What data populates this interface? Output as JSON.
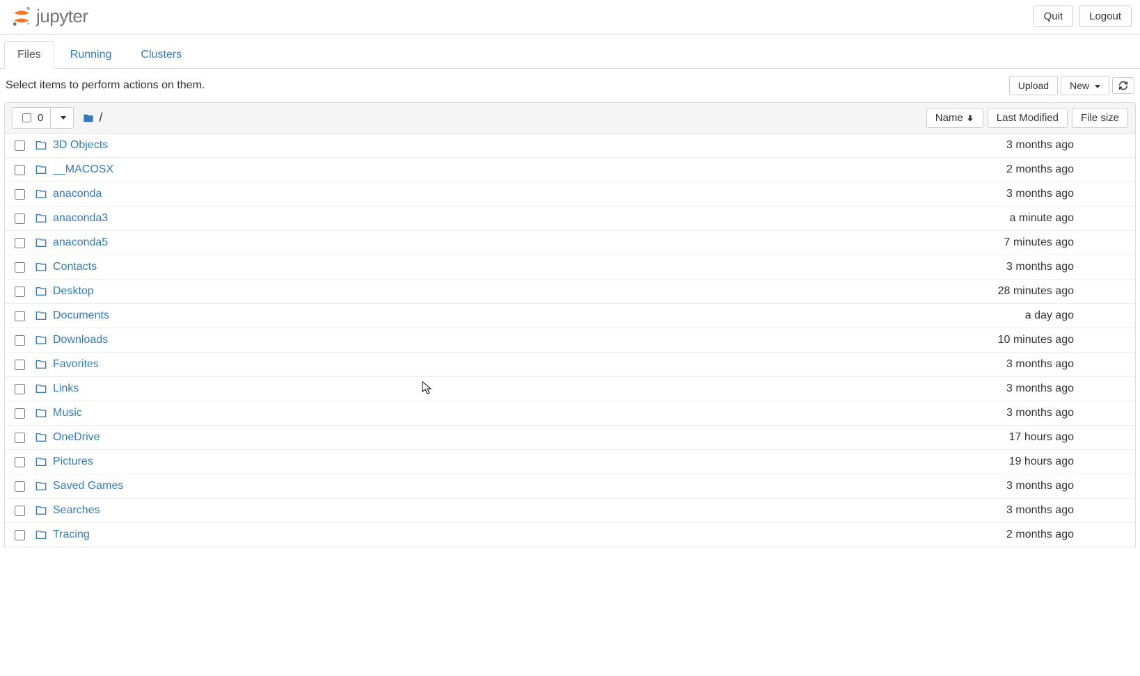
{
  "header": {
    "logo_text": "jupyter",
    "quit_label": "Quit",
    "logout_label": "Logout"
  },
  "tabs": {
    "items": [
      {
        "label": "Files",
        "active": true
      },
      {
        "label": "Running",
        "active": false
      },
      {
        "label": "Clusters",
        "active": false
      }
    ]
  },
  "toolbar": {
    "hint": "Select items to perform actions on them.",
    "upload_label": "Upload",
    "new_label": "New"
  },
  "list_header": {
    "selected_count": "0",
    "breadcrumb_root": "/",
    "name_col": "Name",
    "modified_col": "Last Modified",
    "size_col": "File size"
  },
  "files": [
    {
      "name": "3D Objects",
      "modified": "3 months ago",
      "size": ""
    },
    {
      "name": "__MACOSX",
      "modified": "2 months ago",
      "size": ""
    },
    {
      "name": "anaconda",
      "modified": "3 months ago",
      "size": ""
    },
    {
      "name": "anaconda3",
      "modified": "a minute ago",
      "size": ""
    },
    {
      "name": "anaconda5",
      "modified": "7 minutes ago",
      "size": ""
    },
    {
      "name": "Contacts",
      "modified": "3 months ago",
      "size": ""
    },
    {
      "name": "Desktop",
      "modified": "28 minutes ago",
      "size": ""
    },
    {
      "name": "Documents",
      "modified": "a day ago",
      "size": ""
    },
    {
      "name": "Downloads",
      "modified": "10 minutes ago",
      "size": ""
    },
    {
      "name": "Favorites",
      "modified": "3 months ago",
      "size": ""
    },
    {
      "name": "Links",
      "modified": "3 months ago",
      "size": ""
    },
    {
      "name": "Music",
      "modified": "3 months ago",
      "size": ""
    },
    {
      "name": "OneDrive",
      "modified": "17 hours ago",
      "size": ""
    },
    {
      "name": "Pictures",
      "modified": "19 hours ago",
      "size": ""
    },
    {
      "name": "Saved Games",
      "modified": "3 months ago",
      "size": ""
    },
    {
      "name": "Searches",
      "modified": "3 months ago",
      "size": ""
    },
    {
      "name": "Tracing",
      "modified": "2 months ago",
      "size": ""
    }
  ]
}
